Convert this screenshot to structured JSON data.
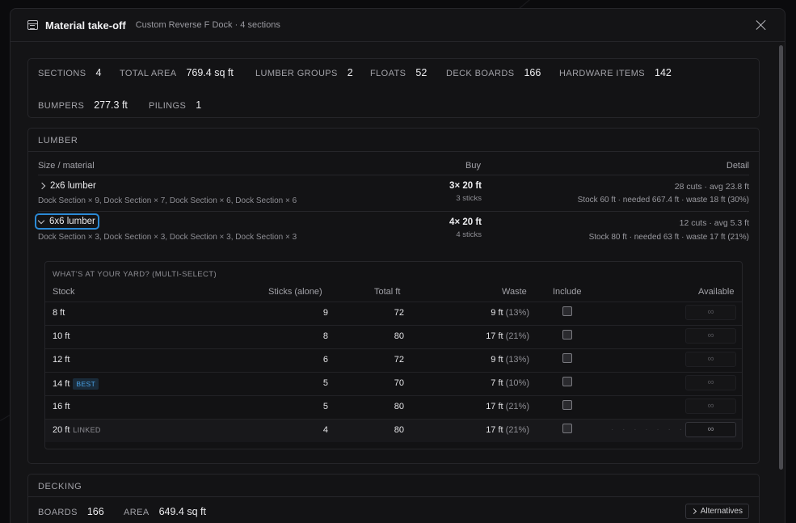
{
  "header": {
    "icon": "table-icon",
    "title": "Material take-off",
    "subtitle": "Custom Reverse F Dock · 4 sections"
  },
  "summary": {
    "sections": {
      "label": "SECTIONS",
      "value": "4"
    },
    "total_area": {
      "label": "TOTAL AREA",
      "value": "769.4 sq ft"
    },
    "lumber_groups": {
      "label": "LUMBER GROUPS",
      "value": "2"
    },
    "floats": {
      "label": "FLOATS",
      "value": "52"
    },
    "deck_boards": {
      "label": "DECK BOARDS",
      "value": "166"
    },
    "hardware_items": {
      "label": "HARDWARE ITEMS",
      "value": "142"
    },
    "bumpers": {
      "label": "BUMPERS",
      "value": "277.3 ft"
    },
    "pilings": {
      "label": "PILINGS",
      "value": "1"
    }
  },
  "lumber": {
    "title": "LUMBER",
    "columns": {
      "size": "Size / material",
      "buy": "Buy",
      "detail": "Detail"
    },
    "rows": [
      {
        "name": "2x6 lumber",
        "sections": "Dock Section × 9, Dock Section × 7, Dock Section × 6, Dock Section × 6",
        "buy": "3× 20 ft",
        "buy_sub": "3 sticks",
        "detail": "28 cuts · avg 23.8 ft",
        "detail_sub": "Stock 60 ft · needed 667.4 ft · waste 18 ft (30%)"
      },
      {
        "name": "6x6 lumber",
        "sections": "Dock Section × 3, Dock Section × 3, Dock Section × 3, Dock Section × 3",
        "buy": "4× 20 ft",
        "buy_sub": "4 sticks",
        "detail": "12 cuts · avg 5.3 ft",
        "detail_sub": "Stock 80 ft · needed 63 ft · waste 17 ft (21%)"
      }
    ],
    "yard": {
      "title": "WHAT'S AT YOUR YARD? (MULTI-SELECT)",
      "columns": {
        "stock": "Stock",
        "sticks": "Sticks (alone)",
        "total": "Total ft",
        "waste": "Waste",
        "include": "Include",
        "available": "Available"
      },
      "rows": [
        {
          "stock": "8 ft",
          "tag": "",
          "sticks": "9",
          "total": "72",
          "waste": "9 ft",
          "waste_pct": "(13%)",
          "available": "∞"
        },
        {
          "stock": "10 ft",
          "tag": "",
          "sticks": "8",
          "total": "80",
          "waste": "17 ft",
          "waste_pct": "(21%)",
          "available": "∞"
        },
        {
          "stock": "12 ft",
          "tag": "",
          "sticks": "6",
          "total": "72",
          "waste": "9 ft",
          "waste_pct": "(13%)",
          "available": "∞"
        },
        {
          "stock": "14 ft",
          "tag": "BEST",
          "sticks": "5",
          "total": "70",
          "waste": "7 ft",
          "waste_pct": "(10%)",
          "available": "∞"
        },
        {
          "stock": "16 ft",
          "tag": "",
          "sticks": "5",
          "total": "80",
          "waste": "17 ft",
          "waste_pct": "(21%)",
          "available": "∞"
        },
        {
          "stock": "20 ft",
          "tag": "LINKED",
          "sticks": "4",
          "total": "80",
          "waste": "17 ft",
          "waste_pct": "(21%)",
          "available": "∞"
        }
      ]
    }
  },
  "decking": {
    "title": "DECKING",
    "boards": {
      "label": "BOARDS",
      "value": "166"
    },
    "area": {
      "label": "AREA",
      "value": "649.4 sq ft"
    },
    "alternatives_label": "Alternatives"
  },
  "colors": {
    "accent_focus": "#2b8ad6",
    "best_tag": "#4aa3e8",
    "background": "#141416"
  }
}
